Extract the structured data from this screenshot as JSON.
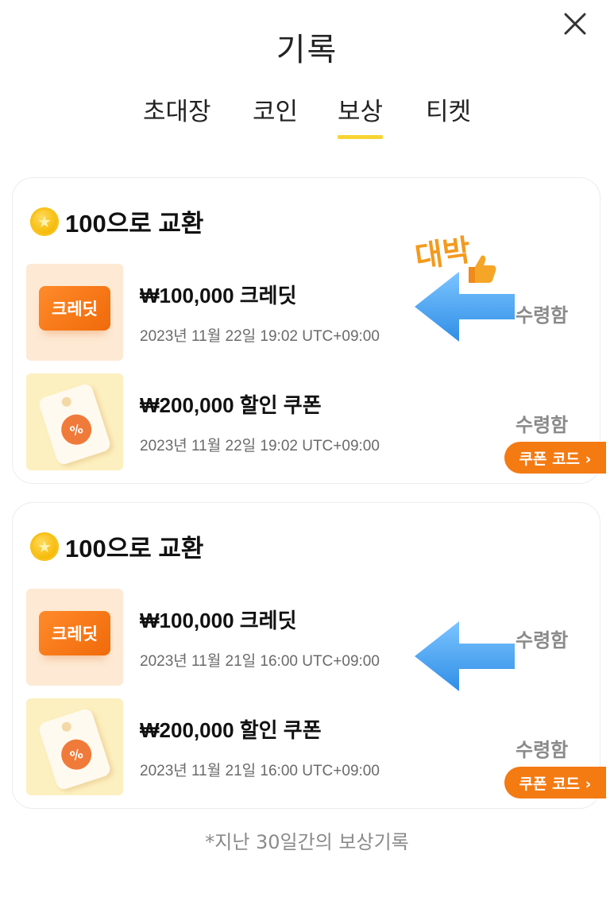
{
  "header": {
    "title": "기록"
  },
  "tabs": [
    "초대장",
    "코인",
    "보상",
    "티켓"
  ],
  "active_tab": "보상",
  "cards": [
    {
      "heading": "100으로 교환",
      "items": [
        {
          "name": "₩100,000 크레딧",
          "date": "2023년 11월 22일 19:02 UTC+09:00",
          "status": "수령함",
          "thumb_label": "크레딧"
        },
        {
          "name": "₩200,000 할인 쿠폰",
          "date": "2023년 11월 22일 19:02 UTC+09:00",
          "status": "수령함",
          "button": "쿠폰 코드 ›",
          "thumb_label": "%"
        }
      ]
    },
    {
      "heading": "100으로 교환",
      "items": [
        {
          "name": "₩100,000 크레딧",
          "date": "2023년 11월 21일 16:00 UTC+09:00",
          "status": "수령함",
          "thumb_label": "크레딧"
        },
        {
          "name": "₩200,000 할인 쿠폰",
          "date": "2023년 11월 21일 16:00 UTC+09:00",
          "status": "수령함",
          "button": "쿠폰 코드 ›",
          "thumb_label": "%"
        }
      ]
    }
  ],
  "annotation": {
    "text": "대박",
    "icon": "thumbs-up-icon",
    "arrow_color": "#3fa2ef",
    "text_color": "#f39a1e"
  },
  "footer": "*지난 30일간의 보상기록",
  "colors": {
    "accent": "#f7d433",
    "coupon_button": "#f47a12",
    "status": "#8a8a8a"
  }
}
